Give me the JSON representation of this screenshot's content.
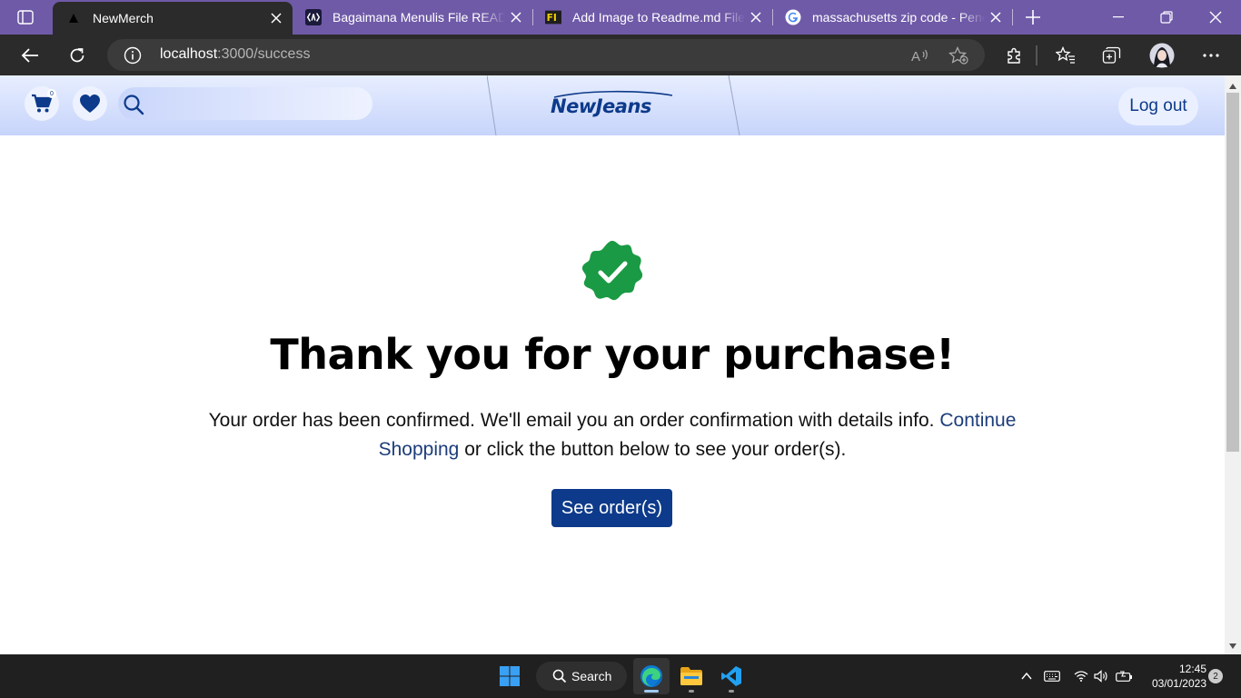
{
  "browser": {
    "tabs": [
      {
        "title": "NewMerch",
        "active": true,
        "favicon": "vercel-triangle-icon"
      },
      {
        "title": "Bagaimana Menulis File README",
        "active": false,
        "favicon": "codepolitan-icon"
      },
      {
        "title": "Add Image to Readme.md File",
        "active": false,
        "favicon": "fi-icon"
      },
      {
        "title": "massachusetts zip code - Penel",
        "active": false,
        "favicon": "google-icon"
      }
    ],
    "url": {
      "host": "localhost",
      "path": ":3000/success"
    }
  },
  "site": {
    "cart_count": "0",
    "search_placeholder": "",
    "logo_text": "NewJeans",
    "logout_label": "Log out"
  },
  "success": {
    "heading": "Thank you for your purchase!",
    "message_before": "Your order has been confirmed. We'll email you an order confirmation with details info. ",
    "continue_link": "Continue Shopping",
    "message_after": " or click the button below to see your order(s).",
    "button_label": "See order(s)"
  },
  "taskbar": {
    "search_label": "Search",
    "time": "12:45",
    "date": "03/01/2023",
    "notification_count": "2"
  },
  "colors": {
    "brand_blue": "#0d3a8a",
    "success_green": "#1a9a44",
    "tabstrip_purple": "#6f5aa8"
  }
}
